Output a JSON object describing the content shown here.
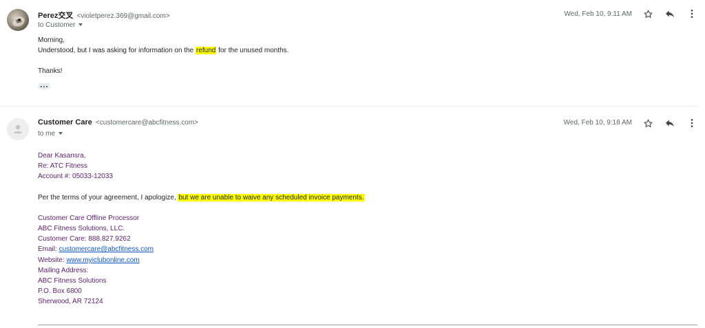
{
  "messages": [
    {
      "sender_name": "Perez交叉",
      "sender_email": "<violetperez.369@gmail.com>",
      "recipient": "to Customer",
      "date": "Wed, Feb 10, 9:11 AM",
      "avatar_icon": "photo-avatar",
      "greeting": "Morning,",
      "line1_pre": "Understood, but I was asking for information on the ",
      "line1_highlight": "refund",
      "line1_post": " for the unused months.",
      "signoff": "Thanks!"
    },
    {
      "sender_name": "Customer Care",
      "sender_email": "<customercare@abcfitness.com>",
      "recipient": "to me",
      "date": "Wed, Feb 10, 9:18 AM",
      "avatar_icon": "default-person-avatar",
      "salutation": "Dear Kasansra,",
      "re_line": "Re: ATC Fitness",
      "account_line": "Account #: 05033-12033",
      "body_pre": "Per the terms of your agreement, I apologize, ",
      "body_highlight": "but we are unable to waive any scheduled invoice payments.",
      "signature": {
        "title": "Customer Care Offline Processor",
        "company": "ABC Fitness Solutions, LLC.",
        "phone": "Customer Care: 888.827.9262",
        "email_label": "Email: ",
        "email_link": "customercare@abcfitness.com",
        "website_label": "Website: ",
        "website_link": "www.myiclubonline.com",
        "mailing_label": "Mailing Address:",
        "addr1": "ABC Fitness Solutions",
        "addr2": "P.O. Box 6800",
        "addr3": "Sherwood, AR 72124"
      }
    }
  ],
  "icons": {
    "star": "star-outline-icon",
    "reply": "reply-icon",
    "more": "more-vertical-icon",
    "expand": "show-trimmed-content-icon"
  },
  "colors": {
    "highlight": "#ffff00",
    "signature_text": "#5b1f6b",
    "link": "#1155cc"
  }
}
